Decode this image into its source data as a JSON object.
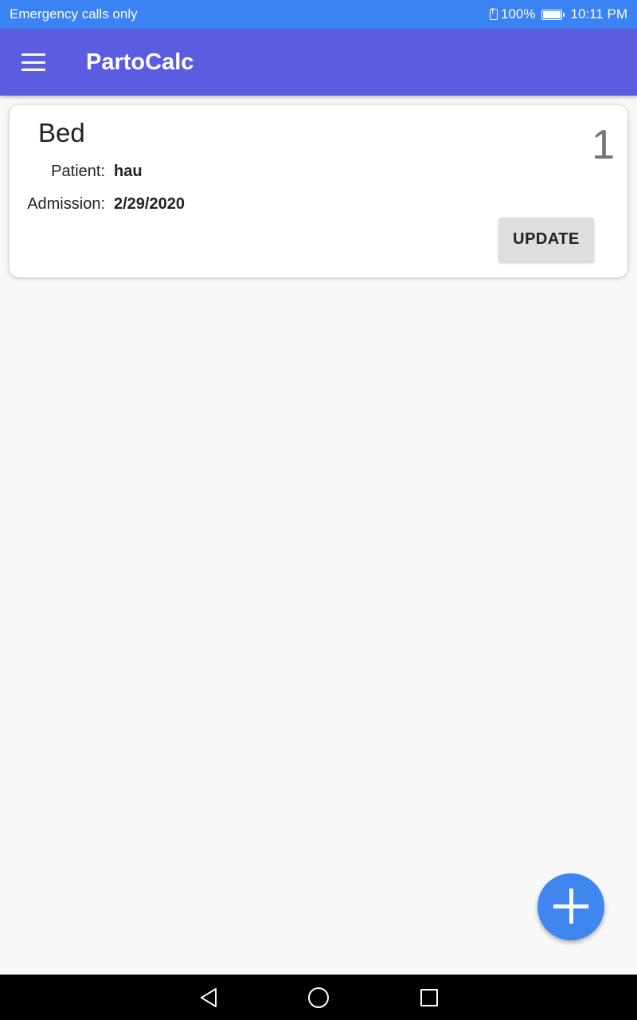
{
  "status_bar": {
    "carrier_text": "Emergency calls only",
    "battery_level": "100%",
    "time": "10:11 PM"
  },
  "app_bar": {
    "title": "PartoCalc",
    "menu_icon": "hamburger-menu-icon"
  },
  "bed_card": {
    "title": "Bed",
    "bed_number": "1",
    "patient_label": "Patient:",
    "patient_value": "hau",
    "admission_label": "Admission:",
    "admission_value": "2/29/2020",
    "update_label": "UPDATE"
  },
  "fab": {
    "icon": "plus-icon"
  },
  "nav_bar": {
    "back_icon": "back-triangle-icon",
    "home_icon": "home-circle-icon",
    "recent_icon": "recent-apps-square-icon"
  },
  "colors": {
    "status_bar": "#3b82f2",
    "app_bar": "#5b5ce0",
    "fab": "#3f86ee",
    "background": "#f8f8f8"
  }
}
